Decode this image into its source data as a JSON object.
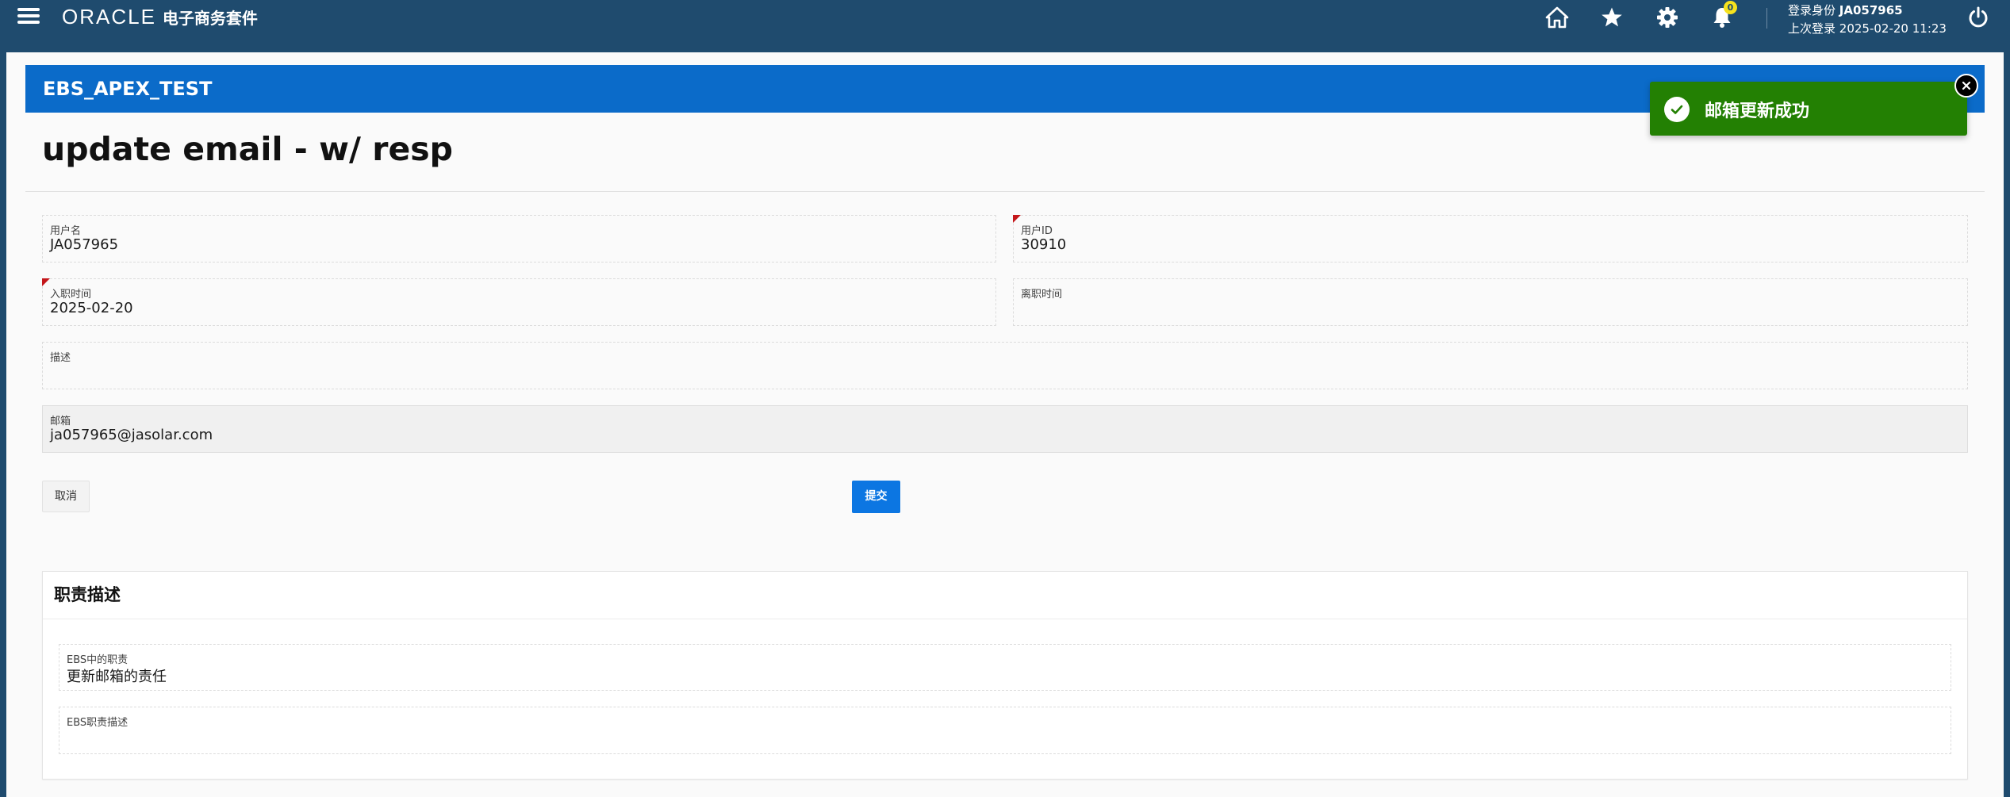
{
  "header": {
    "brand_oracle": "ORACLE",
    "brand_suffix": "电子商务套件",
    "notification_count": "0",
    "user_label": "登录身份",
    "user_id": "JA057965",
    "last_login_label": "上次登录",
    "last_login_value": "2025-02-20 11:23",
    "icons": [
      "menu-icon",
      "home-icon",
      "star-icon",
      "gear-icon",
      "bell-icon",
      "power-icon"
    ],
    "bg_color": "#1f4b6e"
  },
  "region": {
    "title": "EBS_APEX_TEST",
    "color": "#0b6bc9"
  },
  "page": {
    "title": "update email - w/ resp"
  },
  "form": {
    "username": {
      "label": "用户名",
      "value": "JA057965"
    },
    "user_id": {
      "label": "用户ID",
      "value": "30910"
    },
    "hire_date": {
      "label": "入职时间",
      "value": "2025-02-20"
    },
    "leave_date": {
      "label": "离职时间",
      "value": ""
    },
    "description": {
      "label": "描述",
      "value": ""
    },
    "email": {
      "label": "邮箱",
      "value": "ja057965@jasolar.com"
    }
  },
  "buttons": {
    "cancel": "取消",
    "submit": "提交",
    "submit_color": "#0c76e2"
  },
  "responsibility": {
    "title": "职责描述",
    "ebs_resp": {
      "label": "EBS中的职责",
      "value": "更新邮箱的责任"
    },
    "ebs_resp_desc": {
      "label": "EBS职责描述",
      "value": ""
    }
  },
  "toast": {
    "message": "邮箱更新成功",
    "color": "#238003"
  }
}
